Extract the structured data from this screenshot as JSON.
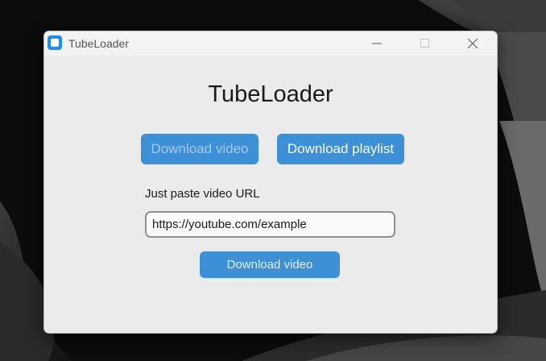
{
  "window": {
    "title": "TubeLoader",
    "controls": {
      "minimize_icon": "minimize-icon",
      "maximize_icon": "maximize-icon",
      "close_icon": "close-icon"
    }
  },
  "app": {
    "heading": "TubeLoader",
    "tabs": [
      {
        "label": "Download video",
        "active": true
      },
      {
        "label": "Download playlist",
        "active": false
      }
    ],
    "url_label": "Just paste video URL",
    "url_input": {
      "value": "https://youtube.com/example",
      "placeholder": ""
    },
    "submit_label": "Download video"
  },
  "colors": {
    "accent": "#3d8fd6",
    "window_bg": "#ebebeb",
    "titlebar_bg": "#f3f3f3",
    "app_icon": "#1d8ef0",
    "desktop_bg": "#0d0d0d"
  }
}
